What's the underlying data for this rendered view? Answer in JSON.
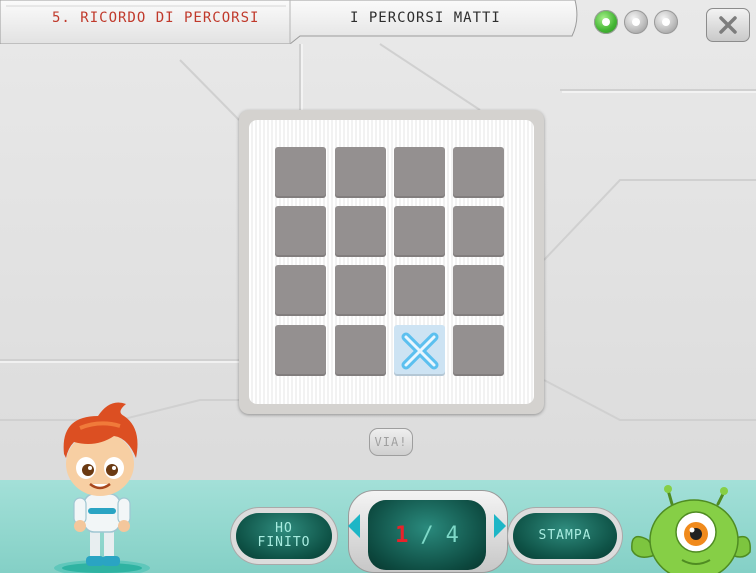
{
  "header": {
    "section_title": "5. RICORDO DI PERCORSI",
    "game_title": "I PERCORSI MATTI",
    "progress_dots": [
      true,
      false,
      false
    ],
    "close_icon": "close-icon"
  },
  "board": {
    "rows": 4,
    "cols": 4,
    "target_cell": {
      "row": 4,
      "col": 3
    },
    "target_icon": "x-mark-icon"
  },
  "buttons": {
    "via": "VIA!",
    "ho_finito_line1": "HO",
    "ho_finito_line2": "FINITO",
    "stampa": "STAMPA"
  },
  "pager": {
    "current": "1",
    "separator": "/",
    "total": "4",
    "prev_icon": "chevron-left-icon",
    "next_icon": "chevron-right-icon"
  },
  "colors": {
    "accent_green": "#44b634",
    "teal": "#0e5246",
    "header_red": "#c0392b",
    "cell_gray": "#949090",
    "target_blue": "#35a9e6"
  }
}
